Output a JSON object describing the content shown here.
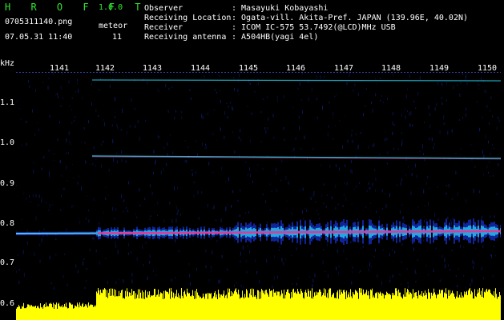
{
  "header": {
    "app_name": "H R O F F T",
    "version": "1.0.0",
    "filename": "0705311140.png",
    "datetime": "07.05.31 11:40",
    "meteor_label": "meteor",
    "meteor_count": "11"
  },
  "info": {
    "observer_label": "Observer",
    "observer_value": ": Masayuki Kobayashi",
    "location_label": "Receiving Location",
    "location_value": ": Ogata-vill. Akita-Pref. JAPAN (139.96E, 40.02N)",
    "receiver_label": "Receiver",
    "receiver_value": ": ICOM IC-575 53.7492(@LCD)MHz USB",
    "antenna_label": "Receiving antenna",
    "antenna_value": ": A504HB(yagi 4el)"
  },
  "axis": {
    "unit": "kHz",
    "x_ticks": [
      "1141",
      "1142",
      "1143",
      "1144",
      "1145",
      "1146",
      "1147",
      "1148",
      "1149",
      "1150"
    ],
    "y_ticks": [
      "1.1",
      "1.0",
      "0.9",
      "0.8",
      "0.7",
      "0.6"
    ]
  },
  "colors": {
    "title_green": "#2ee82e",
    "trace_cyan": "#2be0ff",
    "trace_magenta": "#ff2a8a",
    "level_yellow": "#ffff00",
    "noise_blue": "#0a1a66"
  }
}
